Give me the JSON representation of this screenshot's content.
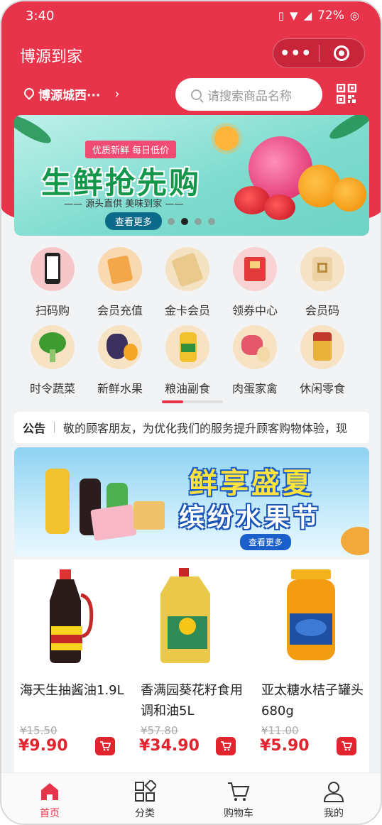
{
  "status": {
    "time": "3:40",
    "battery": "72%"
  },
  "navbar": {
    "title": "博源到家",
    "more_label": "•••"
  },
  "location": {
    "name": "博源城西···",
    "chevron": "›"
  },
  "search": {
    "placeholder": "请搜索商品名称"
  },
  "banner1": {
    "tag": "优质新鲜  每日低价",
    "title": "生鲜抢先购",
    "subtitle": "—— 源头直供   美味到家 ——",
    "button": "查看更多"
  },
  "shortcuts": [
    {
      "label": "扫码购",
      "icon": "phone-scan-icon"
    },
    {
      "label": "会员充值",
      "icon": "recharge-card-icon"
    },
    {
      "label": "金卡会员",
      "icon": "vip-card-icon"
    },
    {
      "label": "领券中心",
      "icon": "coupon-icon"
    },
    {
      "label": "会员码",
      "icon": "member-code-icon"
    },
    {
      "label": "时令蔬菜",
      "icon": "broccoli-icon"
    },
    {
      "label": "新鲜水果",
      "icon": "grapes-icon"
    },
    {
      "label": "粮油副食",
      "icon": "oil-bottle-icon"
    },
    {
      "label": "肉蛋家禽",
      "icon": "meat-icon"
    },
    {
      "label": "休闲零食",
      "icon": "snack-icon"
    }
  ],
  "notice": {
    "tag": "公告",
    "text": "敬的顾客朋友，为优化我们的服务提升顾客购物体验，现"
  },
  "banner2": {
    "title1": "鲜享盛夏",
    "title2": "缤纷水果节",
    "button": "查看更多"
  },
  "products": [
    {
      "name": "海天生抽酱油1.9L",
      "old_price": "¥15.50",
      "price": "¥9.90"
    },
    {
      "name": "香满园葵花籽食用调和油5L",
      "old_price": "¥57.80",
      "price": "¥34.90"
    },
    {
      "name": "亚太糖水桔子罐头680g",
      "old_price": "¥11.00",
      "price": "¥5.90"
    }
  ],
  "tabbar": [
    {
      "label": "首页",
      "active": true
    },
    {
      "label": "分类",
      "active": false
    },
    {
      "label": "购物车",
      "active": false
    },
    {
      "label": "我的",
      "active": false
    }
  ],
  "colors": {
    "brand_red": "#e8344a",
    "price_red": "#e2242f",
    "banner_green": "#12964a"
  }
}
